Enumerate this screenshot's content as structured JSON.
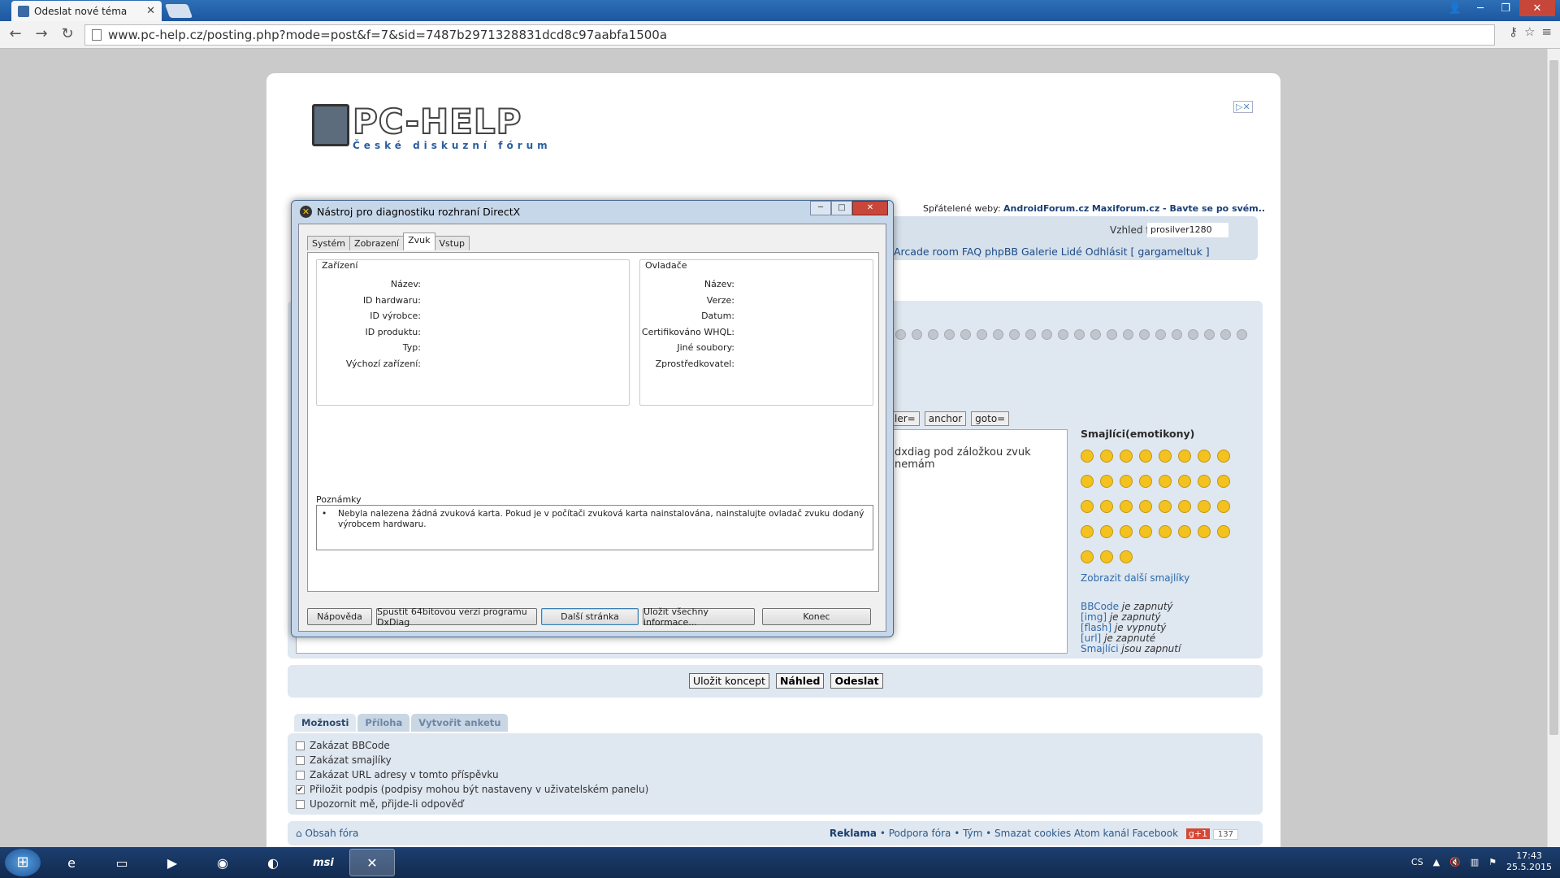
{
  "browser": {
    "tab_title": "Odeslat nové téma",
    "url": "www.pc-help.cz/posting.php?mode=post&f=7&sid=7487b2971328831dcd8c97aabfa1500a",
    "back_icon": "arrow-left-icon",
    "reload_icon": "reload-icon"
  },
  "site": {
    "logo_title": "PC-HELP",
    "logo_subtitle": "České diskuzní fórum",
    "friends_prefix": "Spřátelené weby:",
    "friend1": "AndroidForum.cz",
    "friend2": "Maxiforum.cz - Bavte se po svém..",
    "style_label": "Vzhled fóra:",
    "style_value": "prosilver1280",
    "nav_links": "Arcade room  FAQ phpBB  Galerie  Lidé  Odhlásit [ gargameltuk ]",
    "bb_buttons": [
      "ler=",
      "anchor",
      "goto="
    ],
    "textarea_text": "dxdiag pod záložkou zvuk nemám",
    "smileys_title": "Smajlíci(emotikony)",
    "smileys_more": "Zobrazit další smajlíky",
    "bb_status": [
      {
        "label": "BBCode",
        "mid": " je ",
        "state": "zapnutý"
      },
      {
        "label": "[img]",
        "mid": " je ",
        "state": "zapnutý"
      },
      {
        "label": "[flash]",
        "mid": " je ",
        "state": "vypnutý"
      },
      {
        "label": "[url]",
        "mid": " je ",
        "state": "zapnuté"
      },
      {
        "label": "Smajlíci",
        "mid": " jsou ",
        "state": "zapnutí"
      }
    ],
    "btn_draft": "Uložit koncept",
    "btn_preview": "Náhled",
    "btn_submit": "Odeslat",
    "option_tabs": [
      "Možnosti",
      "Příloha",
      "Vytvořit anketu"
    ],
    "options": [
      {
        "label": "Zakázat BBCode",
        "checked": false
      },
      {
        "label": "Zakázat smajlíky",
        "checked": false
      },
      {
        "label": "Zakázat URL adresy v tomto příspěvku",
        "checked": false
      },
      {
        "label": "Přiložit podpis (podpisy mohou být nastaveny v uživatelském panelu)",
        "checked": true
      },
      {
        "label": "Upozornit mě, přijde-li odpověď",
        "checked": false
      }
    ],
    "footer_home": "Obsah fóra",
    "footer_reklama": "Reklama",
    "footer_links": " • Podpora fóra • Tým • Smazat cookies  Atom kanál  Facebook",
    "gplus": "g+1",
    "gplus_count": "137"
  },
  "dxdiag": {
    "title": "Nástroj pro diagnostiku rozhraní DirectX",
    "tabs": [
      "Systém",
      "Zobrazení",
      "Zvuk",
      "Vstup"
    ],
    "device_group": "Zařízení",
    "device_rows": [
      "Název:",
      "ID hardwaru:",
      "ID výrobce:",
      "ID produktu:",
      "Typ:",
      "Výchozí zařízení:"
    ],
    "driver_group": "Ovladače",
    "driver_rows": [
      "Název:",
      "Verze:",
      "Datum:",
      "Certifikováno WHQL:",
      "Jiné soubory:",
      "Zprostředkovatel:"
    ],
    "notes_title": "Poznámky",
    "notes_text": "Nebyla nalezena žádná zvuková karta. Pokud je v počítači zvuková karta nainstalována, nainstalujte ovladač zvuku dodaný výrobcem hardwaru.",
    "buttons": [
      "Nápověda",
      "Spustit 64bitovou verzi programu DxDiag",
      "Další stránka",
      "Uložit všechny informace...",
      "Konec"
    ]
  },
  "taskbar": {
    "lang": "CS",
    "time": "17:43",
    "date": "25.5.2015",
    "app_msi": "msi"
  }
}
